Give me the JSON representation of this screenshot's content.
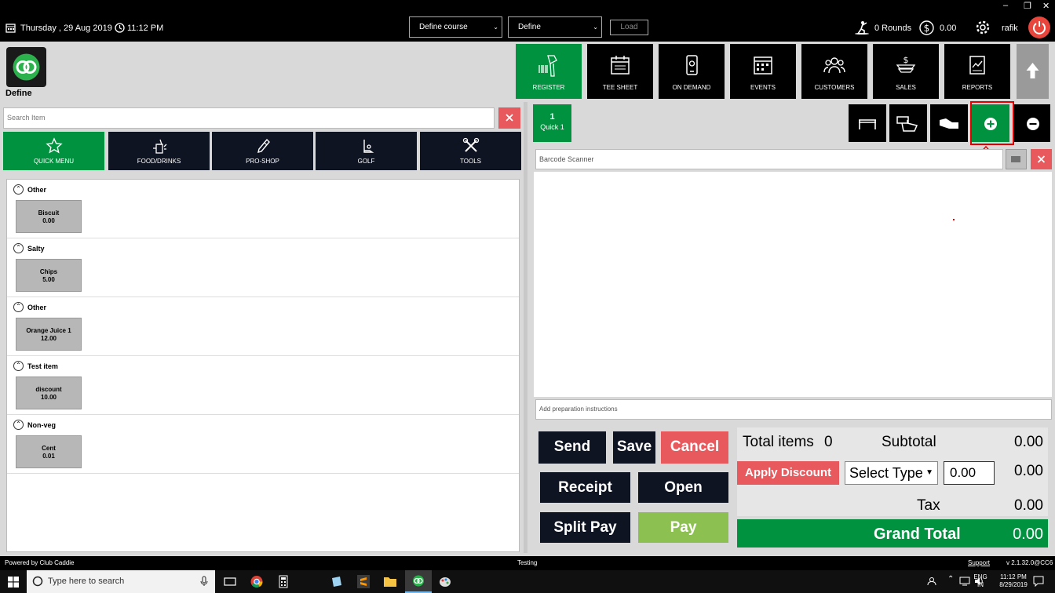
{
  "topbar": {
    "date": "Thursday ,  29 Aug 2019",
    "time": "11:12 PM",
    "course_select": "Define course",
    "define_select": "Define",
    "load_label": "Load",
    "rounds": "0 Rounds",
    "balance": "0.00",
    "user": "rafik"
  },
  "brand": {
    "name": "Define"
  },
  "nav": [
    {
      "label": "REGISTER"
    },
    {
      "label": "TEE SHEET"
    },
    {
      "label": "ON DEMAND"
    },
    {
      "label": "EVENTS"
    },
    {
      "label": "CUSTOMERS"
    },
    {
      "label": "SALES"
    },
    {
      "label": "REPORTS"
    }
  ],
  "search": {
    "placeholder": "Search Item"
  },
  "categories": [
    {
      "label": "QUICK MENU"
    },
    {
      "label": "FOOD/DRINKS"
    },
    {
      "label": "PRO-SHOP"
    },
    {
      "label": "GOLF"
    },
    {
      "label": "TOOLS"
    }
  ],
  "groups": [
    {
      "name": "Other",
      "item": "Biscuit",
      "price": "0.00"
    },
    {
      "name": "Salty",
      "item": "Chips",
      "price": "5.00"
    },
    {
      "name": "Other",
      "item": "Orange Juice 1",
      "price": "12.00"
    },
    {
      "name": "Test item",
      "item": "discount",
      "price": "10.00"
    },
    {
      "name": "Non-veg",
      "item": "Cent",
      "price": "0.01"
    }
  ],
  "order": {
    "tab_number": "1",
    "tab_name": "Quick 1",
    "barcode_placeholder": "Barcode Scanner",
    "prep_placeholder": "Add preparation instructions"
  },
  "actions": {
    "send": "Send",
    "save": "Save",
    "cancel": "Cancel",
    "receipt": "Receipt",
    "open": "Open",
    "split_pay": "Split Pay",
    "pay": "Pay"
  },
  "totals": {
    "total_items_label": "Total items",
    "total_items": "0",
    "subtotal_label": "Subtotal",
    "subtotal": "0.00",
    "apply_discount": "Apply Discount",
    "select_type": "Select Type",
    "discount_input": "0.00",
    "discount": "0.00",
    "tax_label": "Tax",
    "tax": "0.00",
    "grand_total_label": "Grand Total",
    "grand_total": "0.00"
  },
  "footer": {
    "powered_by": "Powered by Club Caddie",
    "env": "Testing",
    "support": "Support",
    "version": "v 2.1.32.0@CC6"
  },
  "taskbar": {
    "search_placeholder": "Type here to search",
    "lang1": "ENG",
    "lang2": "IN",
    "clock_time": "11:12 PM",
    "clock_date": "8/29/2019"
  },
  "colors": {
    "accent_green": "#00923f",
    "danger_red": "#e8595d",
    "nav_dark": "#0f1422",
    "highlight": "#e00000"
  }
}
